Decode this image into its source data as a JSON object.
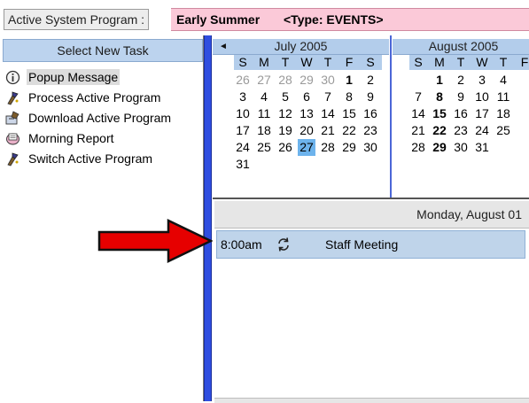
{
  "header": {
    "label": "Active System Program :",
    "program_name": "Early Summer",
    "program_type": "<Type: EVENTS>"
  },
  "task_panel": {
    "title": "Select New Task",
    "items": [
      {
        "label": "Popup Message",
        "icon": "info-icon",
        "selected": true
      },
      {
        "label": "Process Active Program",
        "icon": "wizard-icon",
        "selected": false
      },
      {
        "label": "Download Active Program",
        "icon": "download-icon",
        "selected": false
      },
      {
        "label": "Morning Report",
        "icon": "report-icon",
        "selected": false
      },
      {
        "label": "Switch Active Program",
        "icon": "wizard-icon",
        "selected": false
      }
    ]
  },
  "calendar": {
    "nav_prev": "◄",
    "months": [
      {
        "title": "July 2005",
        "dow": [
          "S",
          "M",
          "T",
          "W",
          "T",
          "F",
          "S"
        ],
        "weeks": [
          [
            "26",
            "27",
            "28",
            "29",
            "30",
            "1",
            "2"
          ],
          [
            "3",
            "4",
            "5",
            "6",
            "7",
            "8",
            "9"
          ],
          [
            "10",
            "11",
            "12",
            "13",
            "14",
            "15",
            "16"
          ],
          [
            "17",
            "18",
            "19",
            "20",
            "21",
            "22",
            "23"
          ],
          [
            "24",
            "25",
            "26",
            "27",
            "28",
            "29",
            "30"
          ],
          [
            "31"
          ]
        ]
      },
      {
        "title": "August 2005",
        "dow": [
          "S",
          "M",
          "T",
          "W",
          "T",
          "F"
        ],
        "weeks": [
          [
            "",
            "1",
            "2",
            "3",
            "4"
          ],
          [
            "7",
            "8",
            "9",
            "10",
            "11"
          ],
          [
            "14",
            "15",
            "16",
            "17",
            "18"
          ],
          [
            "21",
            "22",
            "23",
            "24",
            "25"
          ],
          [
            "28",
            "29",
            "30",
            "31"
          ]
        ]
      }
    ],
    "today": "July 27",
    "bold_dates": [
      "July 1",
      "August 1",
      "August 8",
      "August 15",
      "August 22",
      "August 29"
    ]
  },
  "day_view": {
    "title": "Monday, August 01",
    "appointments": [
      {
        "time": "8:00am",
        "title": "Staff Meeting",
        "recurring": true
      }
    ]
  },
  "colors": {
    "program_box": "#fbc9d8",
    "task_header": "#bcd3ee",
    "divider": "#2f4ee0",
    "calendar_header": "#b3cdeb",
    "today_highlight": "#6db3ec",
    "appointment": "#bfd4ea",
    "arrow": "#e60000"
  }
}
